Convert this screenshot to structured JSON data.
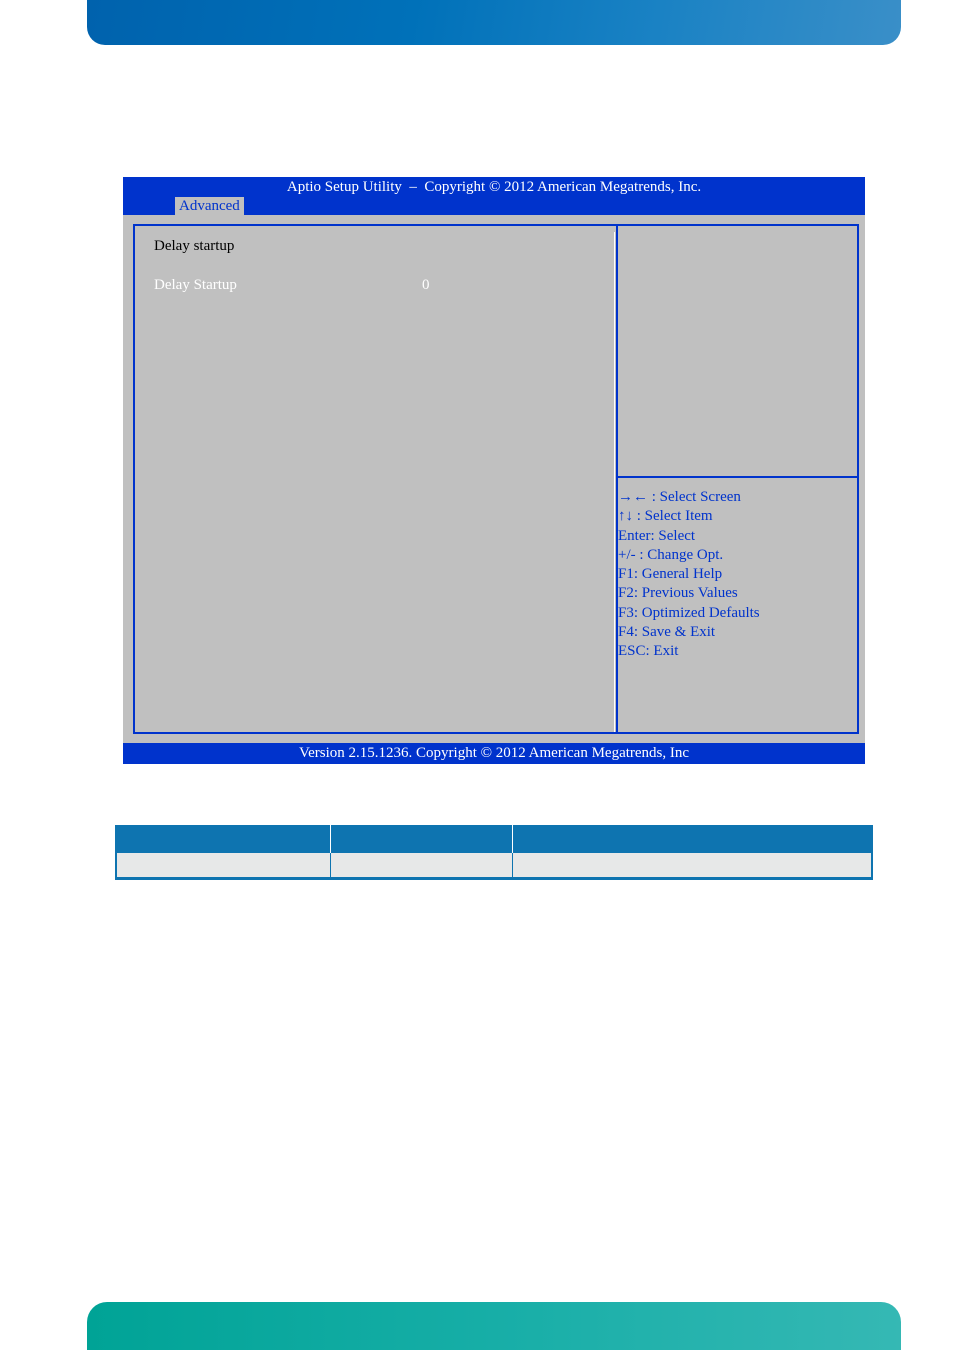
{
  "page": {
    "colors": {
      "top_band": "#0071b9",
      "bottom_band": "#17aea7",
      "table_header": "#0e74b0",
      "table_row": "#e7e8e8"
    }
  },
  "bios": {
    "title": "Aptio Setup Utility  –  Copyright © 2012 American Megatrends, Inc.",
    "active_tab": "Advanced",
    "section_title": "Delay startup",
    "settings": [
      {
        "label": "Delay Startup",
        "value": "0"
      }
    ],
    "help_keys": [
      "→← : Select Screen",
      "↑↓ : Select Item",
      "Enter: Select",
      "+/- : Change Opt.",
      "F1: General Help",
      "F2: Previous Values",
      "F3: Optimized Defaults",
      "F4: Save & Exit",
      "ESC: Exit"
    ],
    "footer": "Version 2.15.1236. Copyright © 2012 American Megatrends, Inc",
    "colors": {
      "bar": "#0033cc",
      "panel": "#c0c0c0",
      "help_text": "#0033cc"
    }
  },
  "table": {
    "headers": [
      "",
      "",
      ""
    ],
    "rows": [
      [
        "",
        "",
        ""
      ]
    ]
  }
}
